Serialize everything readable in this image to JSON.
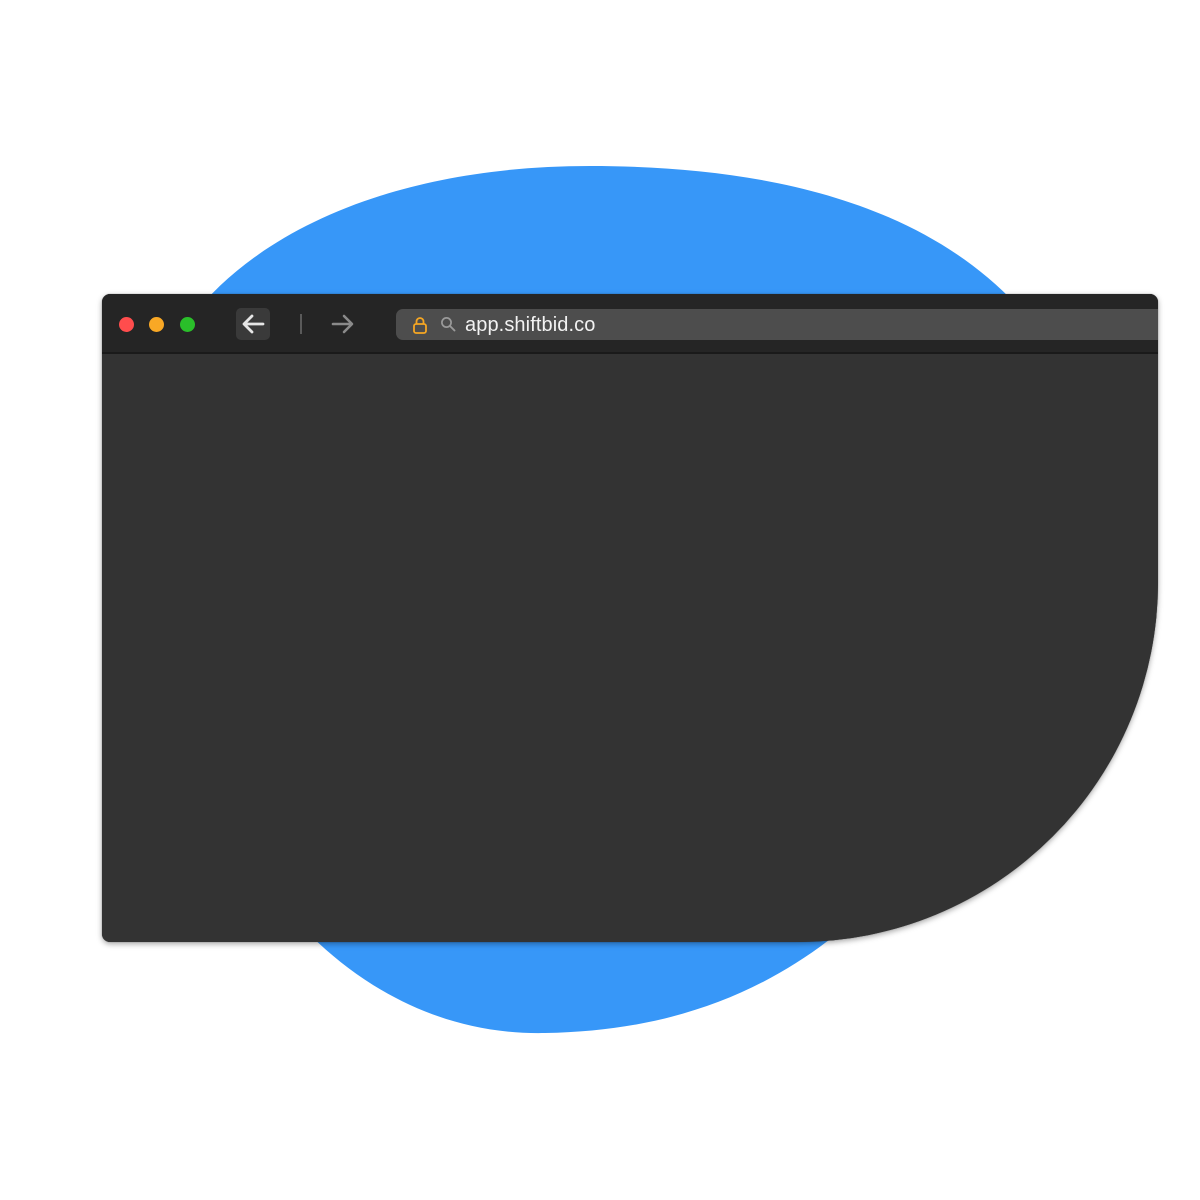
{
  "background": {
    "blob_color": "#3797F8",
    "page_color": "#FFFFFF"
  },
  "browser": {
    "theme": "dark",
    "window_controls": {
      "close_color": "#FF5F57",
      "minimize_color": "#FEBC2E",
      "maximize_color": "#28C840"
    },
    "nav": {
      "back_icon": "arrow-left-icon",
      "forward_icon": "arrow-right-icon",
      "forward_enabled": false
    },
    "address_bar": {
      "url": "app.shiftbid.co",
      "lock_icon": "lock-icon",
      "lock_color": "#F5A623",
      "search_icon": "search-icon"
    },
    "content": {
      "color": "#333333"
    }
  }
}
